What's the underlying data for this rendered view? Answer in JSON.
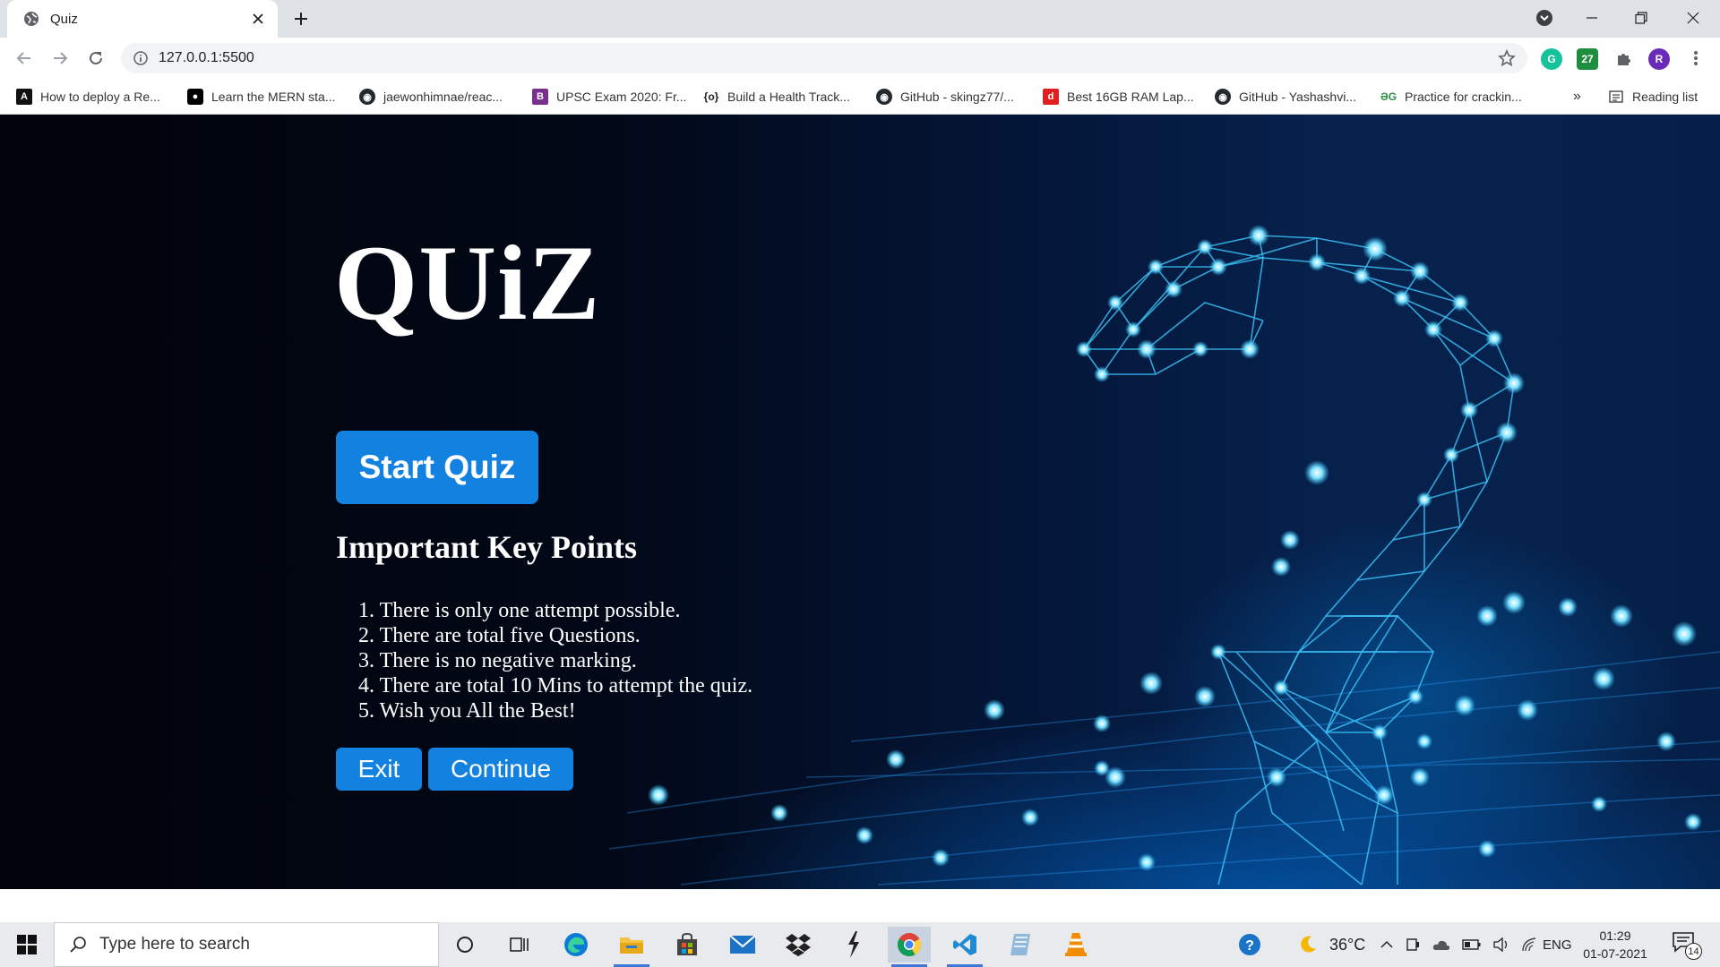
{
  "browser": {
    "tab_title": "Quiz",
    "url": "127.0.0.1:5500",
    "profile_initial": "R",
    "ext_badge": "27",
    "bookmarks": [
      "How to deploy a Re...",
      "Learn the MERN sta...",
      "jaewonhimnae/reac...",
      "UPSC Exam 2020: Fr...",
      "Build a Health Track...",
      "GitHub - skingz77/...",
      "Best 16GB RAM Lap...",
      "GitHub - Yashashvi...",
      "Practice for crackin..."
    ],
    "more_bookmarks": "»",
    "reading_list": "Reading list"
  },
  "page": {
    "title": "QUiZ",
    "start_button": "Start Quiz",
    "key_points_heading": "Important Key Points",
    "key_points": [
      "1. There is only one attempt possible.",
      "2. There are total five Questions.",
      "3. There is no negative marking.",
      "4. There are total 10 Mins to attempt the quiz.",
      "5. Wish you All the Best!"
    ],
    "exit_button": "Exit",
    "continue_button": "Continue"
  },
  "taskbar": {
    "search_placeholder": "Type here to search",
    "temperature": "36°C",
    "language": "ENG",
    "time": "01:29",
    "date": "01-07-2021",
    "notification_count": "14"
  },
  "colors": {
    "button_blue": "#1381e0",
    "tab_strip": "#dee1e6",
    "network_cyan": "#2ec4ff"
  }
}
